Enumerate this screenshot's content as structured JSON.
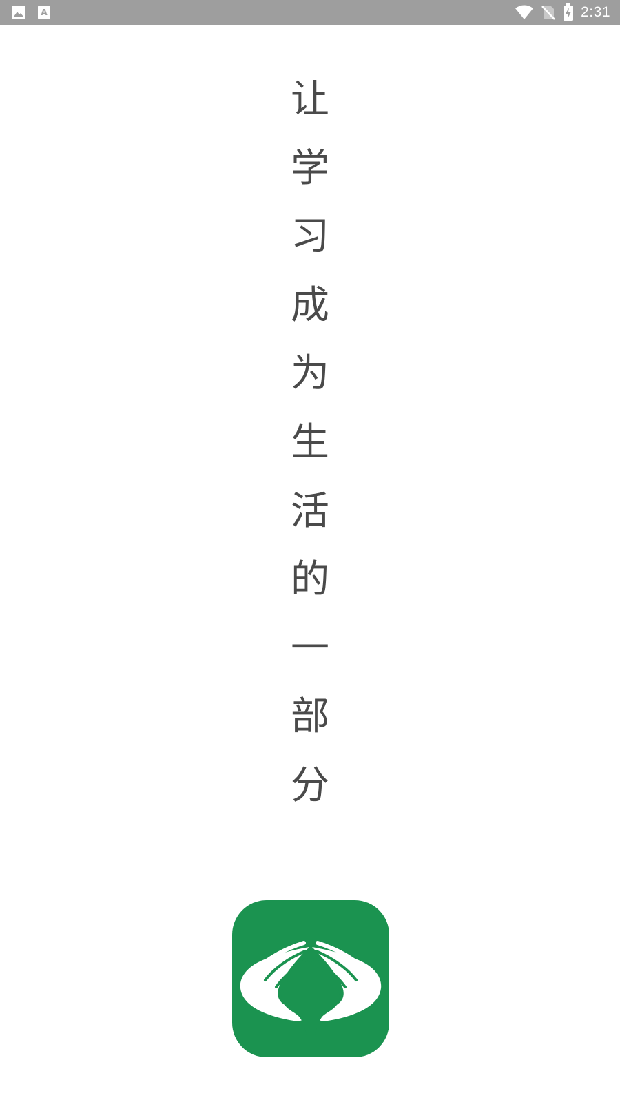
{
  "status_bar": {
    "left_icons": [
      "image-notification-icon",
      "text-notification-icon"
    ],
    "right_icons": [
      "wifi-icon",
      "no-sim-icon",
      "battery-charging-icon"
    ],
    "time": "2:31",
    "background_color": "#9e9e9e"
  },
  "splash": {
    "slogan_chars": [
      "让",
      "学",
      "习",
      "成",
      "为",
      "生",
      "活",
      "的",
      "一",
      "部",
      "分"
    ],
    "text_color": "#4a4a4a",
    "logo": {
      "icon": "hands-logo-icon",
      "background_color": "#1b9350"
    }
  }
}
